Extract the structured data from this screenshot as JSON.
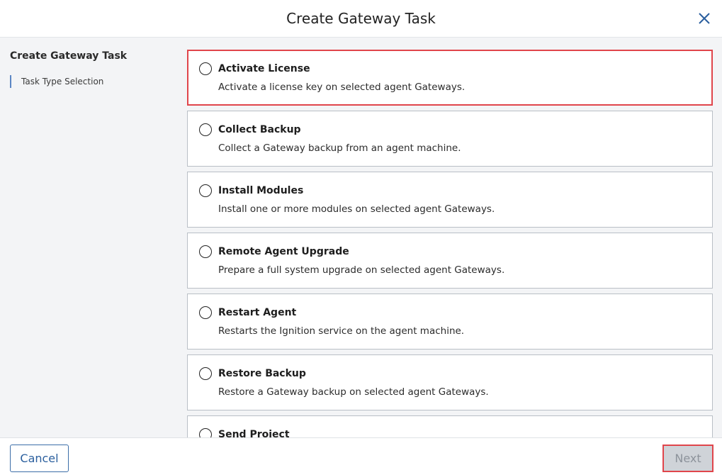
{
  "header": {
    "title": "Create Gateway Task",
    "close_icon": "close-icon"
  },
  "sidebar": {
    "title": "Create Gateway Task",
    "steps": [
      {
        "label": "Task Type Selection"
      }
    ]
  },
  "options": [
    {
      "title": "Activate License",
      "description": "Activate a license key on selected agent Gateways."
    },
    {
      "title": "Collect Backup",
      "description": "Collect a Gateway backup from an agent machine."
    },
    {
      "title": "Install Modules",
      "description": "Install one or more modules on selected agent Gateways."
    },
    {
      "title": "Remote Agent Upgrade",
      "description": "Prepare a full system upgrade on selected agent Gateways."
    },
    {
      "title": "Restart Agent",
      "description": "Restarts the Ignition service on the agent machine."
    },
    {
      "title": "Restore Backup",
      "description": "Restore a Gateway backup on selected agent Gateways."
    },
    {
      "title": "Send Project",
      "description": ""
    }
  ],
  "footer": {
    "cancel_label": "Cancel",
    "next_label": "Next"
  },
  "colors": {
    "accent": "#2b5f9e",
    "highlight": "#e0454b",
    "sidebar_bg": "#f3f4f6"
  }
}
